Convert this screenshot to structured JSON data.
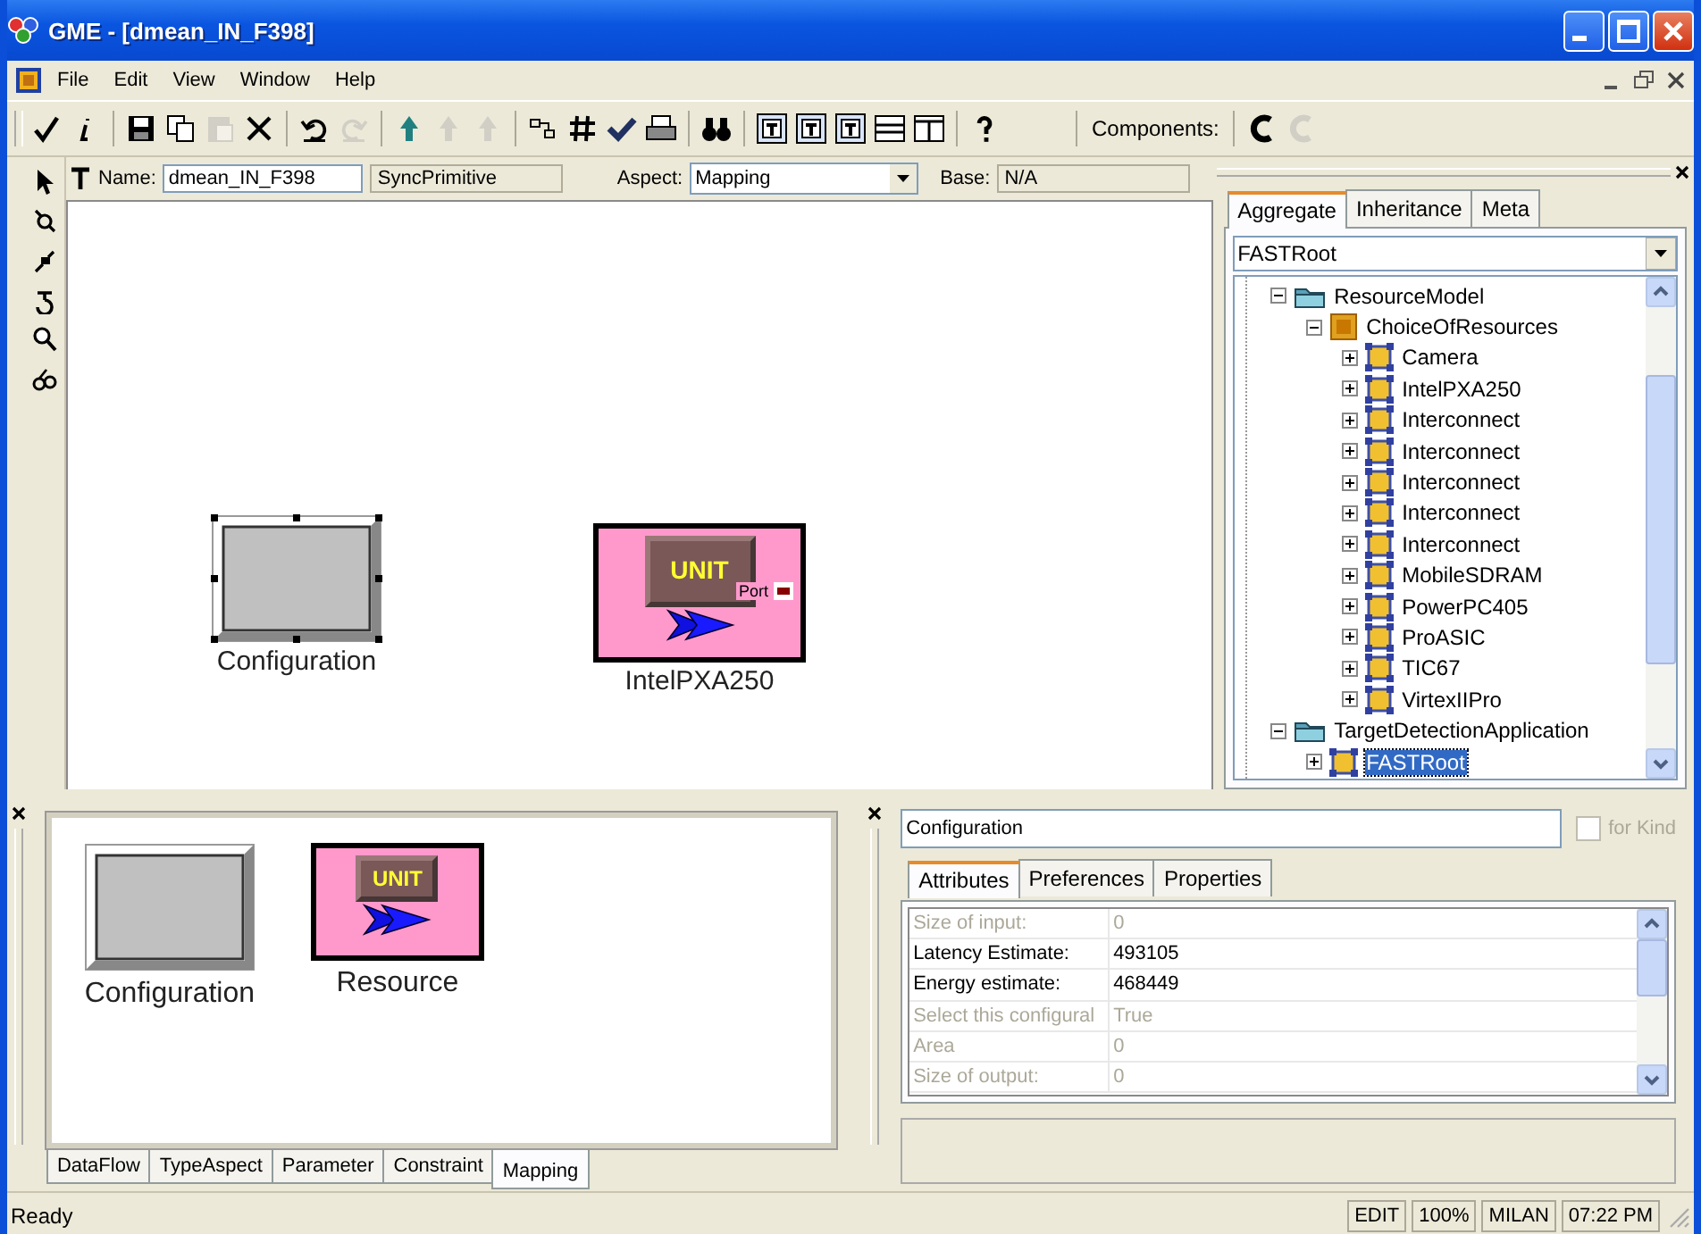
{
  "window": {
    "title": "GME - [dmean_IN_F398]"
  },
  "menu": [
    "File",
    "Edit",
    "View",
    "Window",
    "Help"
  ],
  "toolbar": [
    {
      "disabled": false
    },
    {
      "disabled": false
    },
    {
      "disabled": false
    },
    {
      "disabled": false
    },
    {
      "disabled": true
    },
    {
      "disabled": false
    },
    {
      "disabled": false
    },
    {
      "disabled": true
    },
    {
      "disabled": false
    },
    {
      "disabled": true
    },
    {
      "disabled": true
    },
    {
      "disabled": false
    },
    {
      "disabled": false
    },
    {
      "disabled": false
    },
    {
      "disabled": false
    },
    {
      "disabled": false
    },
    {
      "disabled": false
    },
    {
      "disabled": false
    },
    {
      "disabled": false
    },
    {
      "disabled": false
    },
    {
      "disabled": false
    },
    {
      "disabled": false
    }
  ],
  "components": {
    "label": "Components:",
    "buttons": [
      {
        "disabled": false
      },
      {
        "disabled": true
      }
    ]
  },
  "editor": {
    "name_label": "Name:",
    "name": "dmean_IN_F398",
    "kind": "SyncPrimitive",
    "aspect_label": "Aspect:",
    "aspect": "Mapping",
    "base_label": "Base:",
    "base": "N/A"
  },
  "canvas": {
    "nodes": [
      {
        "kind": "configuration",
        "label": "Configuration",
        "selected": true
      },
      {
        "kind": "unit",
        "label": "IntelPXA250",
        "badge": "UNIT",
        "port": "Port",
        "selected": false
      }
    ]
  },
  "browser": {
    "tabs": [
      {
        "label": "Aggregate",
        "selected": true
      },
      {
        "label": "Inheritance",
        "selected": false
      },
      {
        "label": "Meta",
        "selected": false
      }
    ],
    "selector": "FASTRoot",
    "tree": [
      {
        "label": "ResourceModel",
        "kind": "folder",
        "expanded": true,
        "selected": false,
        "children": [
          {
            "label": "ChoiceOfResources",
            "kind": "choice",
            "expanded": true,
            "selected": false,
            "children": [
              {
                "label": "Camera",
                "kind": "model",
                "expanded": false,
                "selected": false
              },
              {
                "label": "IntelPXA250",
                "kind": "model",
                "expanded": false,
                "selected": false
              },
              {
                "label": "Interconnect",
                "kind": "model",
                "expanded": false,
                "selected": false
              },
              {
                "label": "Interconnect",
                "kind": "model",
                "expanded": false,
                "selected": false
              },
              {
                "label": "Interconnect",
                "kind": "model",
                "expanded": false,
                "selected": false
              },
              {
                "label": "Interconnect",
                "kind": "model",
                "expanded": false,
                "selected": false
              },
              {
                "label": "Interconnect",
                "kind": "model",
                "expanded": false,
                "selected": false
              },
              {
                "label": "MobileSDRAM",
                "kind": "model",
                "expanded": false,
                "selected": false
              },
              {
                "label": "PowerPC405",
                "kind": "model",
                "expanded": false,
                "selected": false
              },
              {
                "label": "ProASIC",
                "kind": "model",
                "expanded": false,
                "selected": false
              },
              {
                "label": "TIC67",
                "kind": "model",
                "expanded": false,
                "selected": false
              },
              {
                "label": "VirtexIIPro",
                "kind": "model",
                "expanded": false,
                "selected": false
              }
            ]
          }
        ]
      },
      {
        "label": "TargetDetectionApplication",
        "kind": "folder",
        "expanded": true,
        "selected": false,
        "children": [
          {
            "label": "FASTRoot",
            "kind": "model",
            "expanded": false,
            "selected": true
          }
        ]
      }
    ]
  },
  "parts": {
    "items": [
      {
        "kind": "configuration",
        "label": "Configuration"
      },
      {
        "kind": "unit",
        "label": "Resource",
        "badge": "UNIT"
      }
    ],
    "tabs": [
      {
        "label": "DataFlow",
        "selected": false
      },
      {
        "label": "TypeAspect",
        "selected": false
      },
      {
        "label": "Parameter",
        "selected": false
      },
      {
        "label": "Constraint",
        "selected": false
      },
      {
        "label": "Mapping",
        "selected": true
      }
    ]
  },
  "inspector": {
    "name": "Configuration",
    "for_kind": {
      "label": "for Kind",
      "checked": false,
      "disabled": true
    },
    "tabs": [
      {
        "label": "Attributes",
        "selected": true
      },
      {
        "label": "Preferences",
        "selected": false
      },
      {
        "label": "Properties",
        "selected": false
      }
    ],
    "rows": [
      {
        "label": "Size of input:",
        "value": "0",
        "disabled": true
      },
      {
        "label": "Latency Estimate:",
        "value": "493105",
        "disabled": false
      },
      {
        "label": "Energy estimate:",
        "value": "468449",
        "disabled": false
      },
      {
        "label": "Select this configural",
        "value": "True",
        "disabled": true
      },
      {
        "label": "Area",
        "value": "0",
        "disabled": true
      },
      {
        "label": "Size of output:",
        "value": "0",
        "disabled": true
      }
    ]
  },
  "status_bar": {
    "message": "Ready",
    "panes": [
      "EDIT",
      "100%",
      "MILAN",
      "07:22 PM"
    ]
  }
}
